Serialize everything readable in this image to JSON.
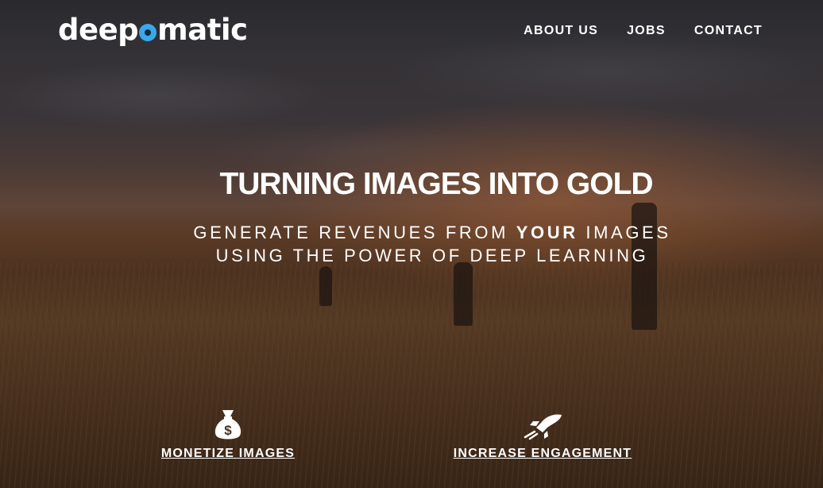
{
  "brand": {
    "logo_before": "deep",
    "logo_after": "matic",
    "accent_color": "#3aa8e8"
  },
  "nav": {
    "items": [
      {
        "label": "ABOUT US"
      },
      {
        "label": "JOBS"
      },
      {
        "label": "CONTACT"
      }
    ]
  },
  "hero": {
    "headline": "TURNING IMAGES INTO GOLD",
    "subline1_before": "GENERATE REVENUES FROM",
    "subline1_emphasis": "YOUR",
    "subline1_after": "IMAGES",
    "subline2": "USING THE POWER OF DEEP LEARNING"
  },
  "features": [
    {
      "icon": "money-bag-icon",
      "label": "MONETIZE IMAGES"
    },
    {
      "icon": "rocket-icon",
      "label": "INCREASE ENGAGEMENT"
    }
  ]
}
